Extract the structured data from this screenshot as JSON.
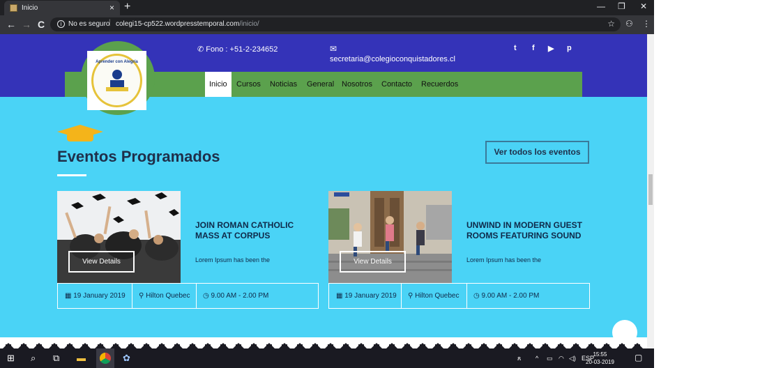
{
  "browser": {
    "tab_title": "Inicio",
    "tab_close": "×",
    "new_tab": "+",
    "minimize": "—",
    "restore": "❐",
    "close": "✕",
    "back": "←",
    "forward": "→",
    "reload": "C",
    "security_text": "No es seguro",
    "url_domain": "colegi15-cp522.wordpresstemporal.com",
    "url_path": "/inicio/",
    "bookmark_icon": "☆"
  },
  "header": {
    "phone": "Fono : +51-2-234652",
    "email": "secretaria@colegioconquistadores.cl",
    "logo_text_top": "Aprender con Alegría",
    "social": [
      "t",
      "f",
      "▶",
      "p"
    ]
  },
  "nav": {
    "items": [
      "Inicio",
      "Cursos",
      "Noticias",
      "General",
      "Nosotros",
      "Contacto",
      "Recuerdos"
    ],
    "active": "Inicio"
  },
  "section": {
    "title": "Eventos Programados",
    "all_events_button": "Ver todos los eventos"
  },
  "events": [
    {
      "title": "JOIN ROMAN CATHOLIC MASS AT CORPUS",
      "desc": "Lorem Ipsum has been the",
      "button": "View Details",
      "date": "19 January 2019",
      "place": "Hilton Quebec",
      "time": "9.00 AM - 2.00 PM"
    },
    {
      "title": "UNWIND IN MODERN GUEST ROOMS FEATURING SOUND",
      "desc": "Lorem Ipsum has been the",
      "button": "View Details",
      "date": "19 January 2019",
      "place": "Hilton Quebec",
      "time": "9.00 AM - 2.00 PM"
    }
  ],
  "taskbar": {
    "lang": "ESP",
    "time": "15:55",
    "date": "20-03-2019"
  },
  "colors": {
    "header_blue": "#3433b8",
    "nav_green": "#5ba14d",
    "section_bg": "#4ad3f6"
  }
}
